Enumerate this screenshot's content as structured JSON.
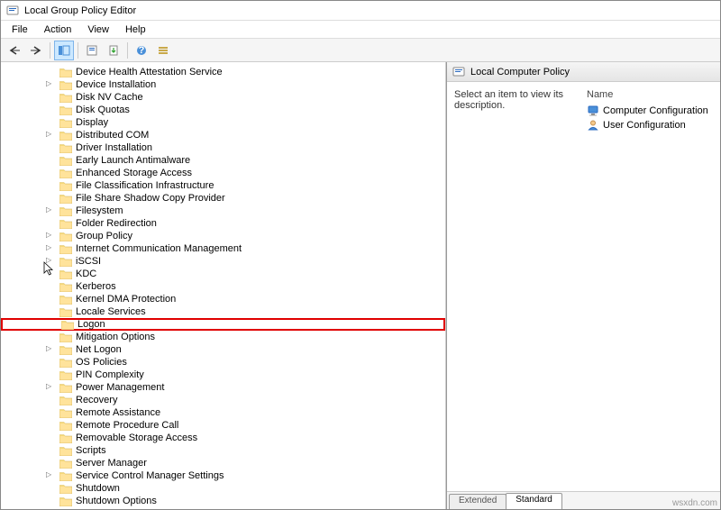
{
  "window": {
    "title": "Local Group Policy Editor"
  },
  "menu": {
    "file": "File",
    "action": "Action",
    "view": "View",
    "help": "Help"
  },
  "tree": [
    {
      "label": "Device Health Attestation Service",
      "exp": false
    },
    {
      "label": "Device Installation",
      "exp": true
    },
    {
      "label": "Disk NV Cache",
      "exp": false
    },
    {
      "label": "Disk Quotas",
      "exp": false
    },
    {
      "label": "Display",
      "exp": false
    },
    {
      "label": "Distributed COM",
      "exp": true
    },
    {
      "label": "Driver Installation",
      "exp": false
    },
    {
      "label": "Early Launch Antimalware",
      "exp": false
    },
    {
      "label": "Enhanced Storage Access",
      "exp": false
    },
    {
      "label": "File Classification Infrastructure",
      "exp": false
    },
    {
      "label": "File Share Shadow Copy Provider",
      "exp": false
    },
    {
      "label": "Filesystem",
      "exp": true
    },
    {
      "label": "Folder Redirection",
      "exp": false
    },
    {
      "label": "Group Policy",
      "exp": true
    },
    {
      "label": "Internet Communication Management",
      "exp": true
    },
    {
      "label": "iSCSI",
      "exp": true
    },
    {
      "label": "KDC",
      "exp": false
    },
    {
      "label": "Kerberos",
      "exp": false
    },
    {
      "label": "Kernel DMA Protection",
      "exp": false
    },
    {
      "label": "Locale Services",
      "exp": false
    },
    {
      "label": "Logon",
      "exp": false,
      "highlight": true
    },
    {
      "label": "Mitigation Options",
      "exp": false
    },
    {
      "label": "Net Logon",
      "exp": true
    },
    {
      "label": "OS Policies",
      "exp": false
    },
    {
      "label": "PIN Complexity",
      "exp": false
    },
    {
      "label": "Power Management",
      "exp": true
    },
    {
      "label": "Recovery",
      "exp": false
    },
    {
      "label": "Remote Assistance",
      "exp": false
    },
    {
      "label": "Remote Procedure Call",
      "exp": false
    },
    {
      "label": "Removable Storage Access",
      "exp": false
    },
    {
      "label": "Scripts",
      "exp": false
    },
    {
      "label": "Server Manager",
      "exp": false
    },
    {
      "label": "Service Control Manager Settings",
      "exp": true
    },
    {
      "label": "Shutdown",
      "exp": false
    },
    {
      "label": "Shutdown Options",
      "exp": false
    }
  ],
  "right": {
    "header": "Local Computer Policy",
    "description": "Select an item to view its description.",
    "nameCol": "Name",
    "items": [
      {
        "label": "Computer Configuration",
        "icon": "computer"
      },
      {
        "label": "User Configuration",
        "icon": "user"
      }
    ]
  },
  "tabs": {
    "extended": "Extended",
    "standard": "Standard"
  },
  "watermark": "wsxdn.com"
}
